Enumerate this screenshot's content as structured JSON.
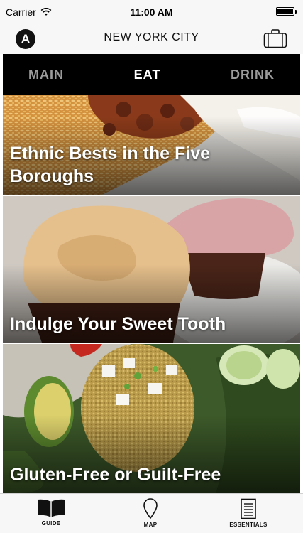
{
  "status_bar": {
    "carrier": "Carrier",
    "time": "11:00 AM",
    "battery_level": 1.0,
    "icons": [
      "wifi-icon",
      "battery-icon"
    ]
  },
  "header": {
    "logo_letter": "A",
    "title": "NEW YORK CITY",
    "icons": [
      "logo-icon",
      "suitcase-icon"
    ]
  },
  "tabs": [
    {
      "label": "MAIN",
      "active": false
    },
    {
      "label": "EAT",
      "active": true
    },
    {
      "label": "DRINK",
      "active": false
    }
  ],
  "cards": [
    {
      "title": "Ethnic Bests in the Five Boroughs"
    },
    {
      "title": "Indulge Your Sweet Tooth"
    },
    {
      "title": "Gluten-Free or Guilt-Free"
    }
  ],
  "bottom_nav": [
    {
      "label": "GUIDE",
      "icon": "book-icon"
    },
    {
      "label": "MAP",
      "icon": "map-pin-icon"
    },
    {
      "label": "ESSENTIALS",
      "icon": "document-icon"
    }
  ],
  "colors": {
    "tab_bar_bg": "#000000",
    "tab_active": "#ffffff",
    "tab_inactive": "#9a9a9a",
    "chrome_bg": "#f7f7f7"
  }
}
